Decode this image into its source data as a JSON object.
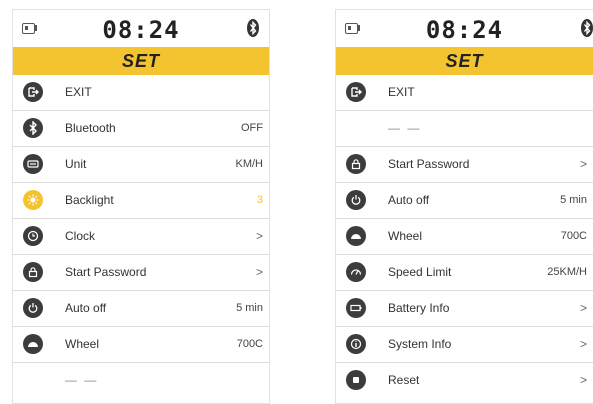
{
  "left": {
    "time": "08:24",
    "title": "SET",
    "rows": [
      {
        "label": "EXIT",
        "value": "",
        "icon": "exit-icon"
      },
      {
        "label": "Bluetooth",
        "value": "OFF",
        "icon": "bluetooth-icon"
      },
      {
        "label": "Unit",
        "value": "KM/H",
        "icon": "unit-icon"
      },
      {
        "label": "Backlight",
        "value": "3",
        "icon": "backlight-icon"
      },
      {
        "label": "Clock",
        "value": ">",
        "icon": "clock-icon"
      },
      {
        "label": "Start Password",
        "value": ">",
        "icon": "lock-icon"
      },
      {
        "label": "Auto off",
        "value": "5 min",
        "icon": "power-icon"
      },
      {
        "label": "Wheel",
        "value": "700C",
        "icon": "wheel-icon"
      },
      {
        "label": "— —",
        "value": ""
      }
    ]
  },
  "right": {
    "time": "08:24",
    "title": "SET",
    "rows": [
      {
        "label": "EXIT",
        "value": "",
        "icon": "exit-icon"
      },
      {
        "label": "— —",
        "value": ""
      },
      {
        "label": "Start Password",
        "value": ">",
        "icon": "lock-icon"
      },
      {
        "label": "Auto off",
        "value": "5 min",
        "icon": "power-icon"
      },
      {
        "label": "Wheel",
        "value": "700C",
        "icon": "wheel-icon"
      },
      {
        "label": "Speed Limit",
        "value": "25KM/H",
        "icon": "speed-limit-icon"
      },
      {
        "label": "Battery Info",
        "value": ">",
        "icon": "battery-info-icon"
      },
      {
        "label": "System Info",
        "value": ">",
        "icon": "system-info-icon"
      },
      {
        "label": "Reset",
        "value": ">",
        "icon": "reset-icon"
      }
    ]
  },
  "colors": {
    "accent": "#f4c430",
    "icon_bg": "#3c3c3c",
    "text": "#333333"
  }
}
